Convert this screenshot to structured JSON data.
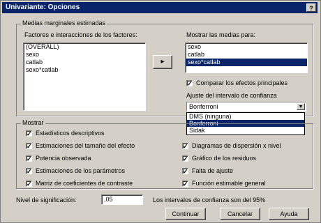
{
  "window": {
    "title": "Univariante: Opciones",
    "help_glyph": "?"
  },
  "estimated_means": {
    "group_label": "Medias marginales estimadas",
    "factors_label": "Factores e interacciones de los factores:",
    "factors_items": [
      "(OVERALL)",
      "sexo",
      "catlab",
      "sexo*catlab"
    ],
    "move_button_label": "▸",
    "display_label": "Mostrar las medias para:",
    "display_items": [
      "sexo",
      "catlab",
      "sexo*catlab"
    ],
    "display_selected_index": 2,
    "compare_effects_label": "Comparar los efectos principales",
    "compare_effects_checked": true,
    "ci_adjust_label": "Ajuste del intervalo de confianza",
    "ci_adjust_value": "Bonferroni",
    "ci_adjust_options": [
      "DMS (ninguna)",
      "Bonferroni",
      "Sidak"
    ],
    "ci_adjust_selected_index": 1
  },
  "show": {
    "group_label": "Mostrar",
    "left_items": [
      {
        "label": "Estadísticos descriptivos",
        "checked": true
      },
      {
        "label": "Estimaciones del tamaño del efecto",
        "checked": true
      },
      {
        "label": "Potencia observada",
        "checked": true
      },
      {
        "label": "Estimaciones de los parámetros",
        "checked": true
      },
      {
        "label": "Matriz de coeficientes de contraste",
        "checked": true
      }
    ],
    "right_items": [
      {
        "label": "Diagramas de dispersión x nivel",
        "checked": true
      },
      {
        "label": "Gráfico de los residuos",
        "checked": true
      },
      {
        "label": "Falta de ajuste",
        "checked": true
      },
      {
        "label": "Función estimable general",
        "checked": true
      }
    ],
    "check_glyph": "✓"
  },
  "significance": {
    "label": "Nivel de significación:",
    "value": ",05",
    "note": "Los intervalos de confianza son del 95%"
  },
  "buttons": {
    "continue": "Continuar",
    "cancel": "Cancelar",
    "help": "Ayuda"
  }
}
